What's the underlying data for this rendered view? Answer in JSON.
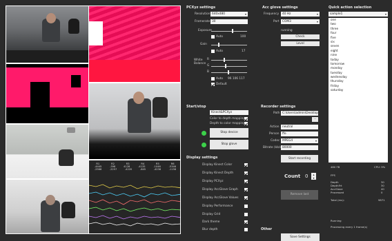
{
  "video": {
    "top_left": "color-feed",
    "top_right": "depth-feed",
    "mid_left": "depth-masked",
    "mid_right": "color-feed-2",
    "bottom_left_top": "ir-feed",
    "bottom_left_bottom": "ir-feed-2"
  },
  "pcxs": {
    "title": "PCXyz settings",
    "resolution_label": "Resolution",
    "resolution_value": "640x480",
    "framerate_label": "Framerate",
    "framerate_value": "30",
    "exposure_label": "Exposure",
    "exposure_auto_label": "Auto",
    "exposure_val": "100",
    "gain_label": "Gain",
    "gain_auto_label": "Auto",
    "gain_val": "17",
    "wb_label": "White\nBalance",
    "wb_r": "R",
    "wb_g": "G",
    "wb_b": "B",
    "wb_auto_label": "Auto",
    "wb_vals": "96  106  117",
    "default_label": "Default"
  },
  "acc": {
    "title": "Acc glove settings",
    "frequency_label": "Frequency",
    "frequency_value": "40 Hz",
    "port_label": "Port",
    "port_value": "COM3",
    "status": "running",
    "check_label": "Check",
    "level_label": "Level"
  },
  "quick": {
    "title": "Quick action selection",
    "selected": "sample1",
    "items": [
      "one",
      "two",
      "three",
      "four",
      "five",
      "six",
      "seven",
      "eight",
      "nine",
      "today",
      "tomorrow",
      "monday",
      "tuesday",
      "wednesday",
      "thursday",
      "friday",
      "saturday"
    ]
  },
  "startstop": {
    "title": "Start/stop",
    "source_value": "Kinect&PCXyz",
    "color_depth_label": "Color to depth mapping",
    "depth_color_label": "Depth to color mapping",
    "stop_device_label": "Stop device",
    "stop_glove_label": "Stop glove"
  },
  "recorder": {
    "title": "Recorder settings",
    "path_label": "Path",
    "path_value": "C:\\Users\\admin\\Desktop\\re",
    "browse_label": "...",
    "action_label": "Action",
    "action_value": "neutral",
    "person_label": "Person",
    "person_value": "ffe",
    "codec_label": "Codec",
    "codec_value": "MPEG4",
    "bitrate_label": "Bitrate (kb/s)",
    "bitrate_value": "80000",
    "start_label": "Start recording",
    "count_label": "Count",
    "count_value": "0",
    "remove_label": "Remove last"
  },
  "display": {
    "title": "Display settings",
    "items": [
      {
        "label": "Display Kinect Color",
        "checked": true
      },
      {
        "label": "Display Kinect Depth",
        "checked": true
      },
      {
        "label": "Display PCXyz",
        "checked": true
      },
      {
        "label": "Display AccGlove Graph",
        "checked": true
      },
      {
        "label": "Display AccGlove Values",
        "checked": true
      },
      {
        "label": "Display Performance",
        "checked": false
      },
      {
        "label": "Display Grid",
        "checked": false
      },
      {
        "label": "Dark theme",
        "checked": true
      },
      {
        "label": "Blur depth",
        "checked": false
      }
    ]
  },
  "other": {
    "title": "Other",
    "save_label": "Save Settings"
  },
  "perf": {
    "res_label": "480 FB",
    "cpu_label": "CPU: 9%",
    "fps_label": "FPS",
    "rows": [
      {
        "k": "Depth",
        "v": "30"
      },
      {
        "k": "DepthFrt",
        "v": "30"
      },
      {
        "k": "AccGlove",
        "v": "40"
      },
      {
        "k": "Processed",
        "v": "0"
      }
    ],
    "total_label": "Total (ms):",
    "total_value": "9871",
    "status": "Running",
    "processing": "Processing every 1 frame(s)"
  },
  "graph_table": {
    "header": [
      "R1",
      "R2",
      "R3",
      "R4",
      "R5",
      "R6",
      "R7"
    ],
    "row1": [
      "-4445",
      "-598",
      "4128",
      "-4135",
      "-1046",
      "-5346",
      ""
    ],
    "row2": [
      "-2566",
      "-2257",
      "-4220",
      "-845",
      "-4236",
      "-1156",
      ""
    ]
  },
  "colors": {
    "background": "#2b2b2b",
    "depth_red": "#ff1640",
    "depth_magenta": "#ff0e5f",
    "status_green": "#3cd14a"
  }
}
